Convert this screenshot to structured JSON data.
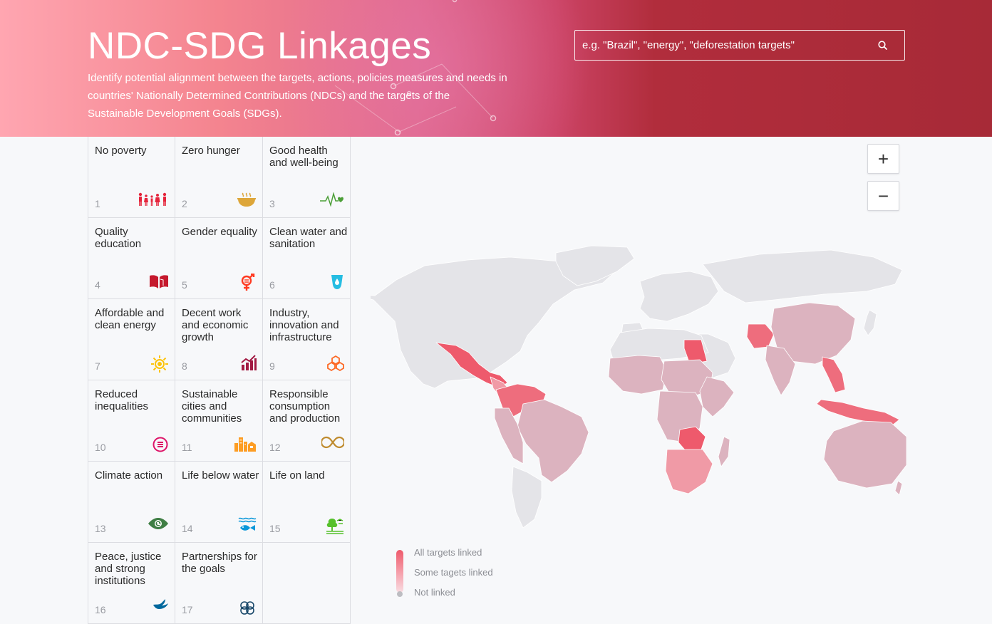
{
  "header": {
    "title": "NDC-SDG Linkages",
    "description": "Identify potential alignment between the targets, actions, policies measures and needs in countries' Nationally Determined Contributions (NDCs) and the targets of the Sustainable Development Goals (SDGs).",
    "search_placeholder": "e.g. \"Brazil\", \"energy\", \"deforestation targets\"",
    "search_icon": "search-icon"
  },
  "goals": [
    {
      "number": "1",
      "label": "No poverty",
      "color": "#e5243b",
      "icon": "people-icon"
    },
    {
      "number": "2",
      "label": "Zero hunger",
      "color": "#dda63a",
      "icon": "bowl-icon"
    },
    {
      "number": "3",
      "label": "Good health and well-being",
      "color": "#4c9f38",
      "icon": "heartbeat-icon"
    },
    {
      "number": "4",
      "label": "Quality education",
      "color": "#c5192d",
      "icon": "book-icon"
    },
    {
      "number": "5",
      "label": "Gender equality",
      "color": "#ff3a21",
      "icon": "gender-icon"
    },
    {
      "number": "6",
      "label": "Clean water and sanitation",
      "color": "#26bde2",
      "icon": "water-drop-icon"
    },
    {
      "number": "7",
      "label": "Affordable and clean energy",
      "color": "#fcc30b",
      "icon": "sun-icon"
    },
    {
      "number": "8",
      "label": "Decent work and economic growth",
      "color": "#a21942",
      "icon": "growth-chart-icon"
    },
    {
      "number": "9",
      "label": "Industry, innovation and infrastructure",
      "color": "#fd6925",
      "icon": "cubes-icon"
    },
    {
      "number": "10",
      "label": "Reduced inequalities",
      "color": "#dd1367",
      "icon": "equal-icon"
    },
    {
      "number": "11",
      "label": "Sustainable cities and communities",
      "color": "#fd9d24",
      "icon": "city-icon"
    },
    {
      "number": "12",
      "label": "Responsible consumption and production",
      "color": "#bf8b2e",
      "icon": "infinity-icon"
    },
    {
      "number": "13",
      "label": "Climate action",
      "color": "#3f7e44",
      "icon": "eye-globe-icon"
    },
    {
      "number": "14",
      "label": "Life below water",
      "color": "#0a97d9",
      "icon": "fish-icon"
    },
    {
      "number": "15",
      "label": "Life on land",
      "color": "#56c02b",
      "icon": "tree-icon"
    },
    {
      "number": "16",
      "label": "Peace, justice and strong institutions",
      "color": "#00689d",
      "icon": "dove-icon"
    },
    {
      "number": "17",
      "label": "Partnerships for the goals",
      "color": "#19486a",
      "icon": "rings-icon"
    }
  ],
  "map": {
    "zoom_in_label": "+",
    "zoom_out_label": "−",
    "colors": {
      "all": "#ee5a6c",
      "some": "#dcb3bf",
      "none": "#e4e4e8",
      "ocean": "#f7f8fa"
    }
  },
  "legend": {
    "all": "All targets linked",
    "some": "Some tagets linked",
    "none": "Not linked"
  }
}
